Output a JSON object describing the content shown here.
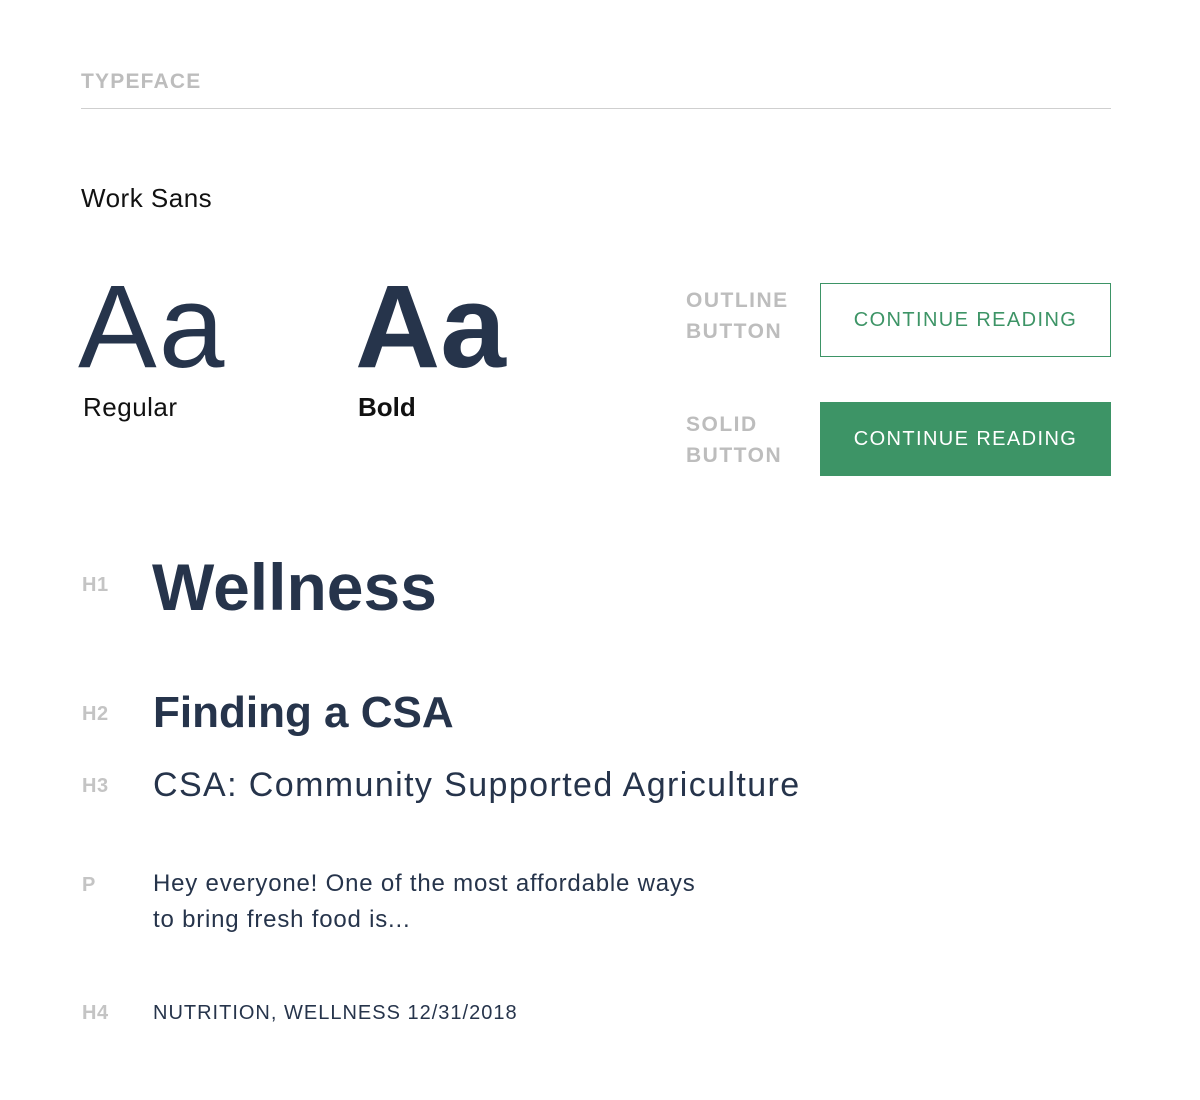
{
  "section": {
    "title": "TYPEFACE"
  },
  "typeface": {
    "name": "Work Sans",
    "specimen": "Aa",
    "weights": {
      "regular": "Regular",
      "bold": "Bold"
    }
  },
  "buttons": {
    "outline": {
      "label_line1": "OUTLINE",
      "label_line2": "BUTTON",
      "text": "CONTINUE READING"
    },
    "solid": {
      "label_line1": "SOLID",
      "label_line2": "BUTTON",
      "text": "CONTINUE READING"
    }
  },
  "samples": {
    "h1": {
      "tag": "H1",
      "text": "Wellness"
    },
    "h2": {
      "tag": "H2",
      "text": "Finding a CSA"
    },
    "h3": {
      "tag": "H3",
      "text": "CSA: Community Supported Agriculture"
    },
    "p": {
      "tag": "P",
      "line1": "Hey everyone! One of the most affordable ways",
      "line2": "to bring fresh food is..."
    },
    "h4": {
      "tag": "H4",
      "text": "NUTRITION, WELLNESS 12/31/2018"
    }
  },
  "colors": {
    "primary_text": "#26344b",
    "accent_green": "#3d9466",
    "muted_label": "#bdbdbd",
    "divider": "#cfcfcf"
  }
}
